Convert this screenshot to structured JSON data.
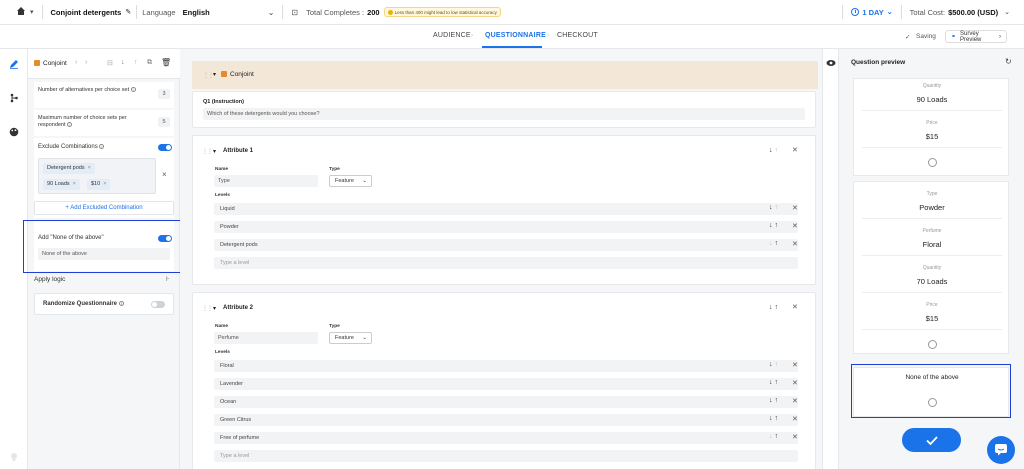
{
  "topbar": {
    "title": "Conjoint detergents",
    "language_label": "Language",
    "language_value": "English",
    "completes_label": "Total Completes :",
    "completes_value": "200",
    "warning_text": "Less than 400 might lead to low statistical accuracy",
    "duration": "1 DAY",
    "cost_label": "Total Cost:",
    "cost_value": "$500.00 (USD)"
  },
  "tabs": [
    {
      "label": "AUDIENCE"
    },
    {
      "label": "QUESTIONNAIRE"
    },
    {
      "label": "CHECKOUT"
    }
  ],
  "tabbar": {
    "saving": "Saving",
    "survey_preview": "Survey Preview"
  },
  "left_panel": {
    "block_name": "Conjoint",
    "alternatives_label": "Number of alternatives per choice set",
    "alternatives_value": "3",
    "max_choice_label": "Maximum number of choice sets per respondent",
    "max_choice_value": "5",
    "exclude_label": "Exclude Combinations",
    "exclude_chips": [
      "Detergent pods",
      "90 Loads",
      "$10"
    ],
    "add_excluded": "+ Add Excluded Combination",
    "none_label": "Add \"None of the above\"",
    "none_value": "None of the above",
    "apply_logic": "Apply logic",
    "randomize": "Randomize Questionnaire"
  },
  "main": {
    "block_title": "Conjoint",
    "q1_label": "Q1 (Instruction)",
    "q1_text": "Which of these detergents would you choose?",
    "attribute1": {
      "title": "Attribute 1",
      "name_label": "Name",
      "name_value": "Type",
      "type_label": "Type",
      "type_value": "Feature",
      "levels_label": "Levels",
      "levels": [
        "Liquid",
        "Powder",
        "Detergent pods"
      ],
      "placeholder": "Type a level"
    },
    "attribute2": {
      "title": "Attribute 2",
      "name_label": "Name",
      "name_value": "Perfume",
      "type_label": "Type",
      "type_value": "Feature",
      "levels_label": "Levels",
      "levels": [
        "Floral",
        "Lavender",
        "Ocean",
        "Green Citrus",
        "Free of perfume"
      ],
      "placeholder": "Type a level"
    }
  },
  "preview": {
    "title": "Question preview",
    "card1": {
      "quantity_label": "Quantity",
      "quantity": "90 Loads",
      "price_label": "Price",
      "price": "$15"
    },
    "card2": {
      "type_label": "Type",
      "type": "Powder",
      "perfume_label": "Perfume",
      "perfume": "Floral",
      "quantity_label": "Quantity",
      "quantity": "70 Loads",
      "price_label": "Price",
      "price": "$15"
    },
    "none_text": "None of the above"
  },
  "colors": {
    "accent": "#1a73e8",
    "highlight": "#1f3fd6",
    "block_bg": "#f3e7d8"
  }
}
